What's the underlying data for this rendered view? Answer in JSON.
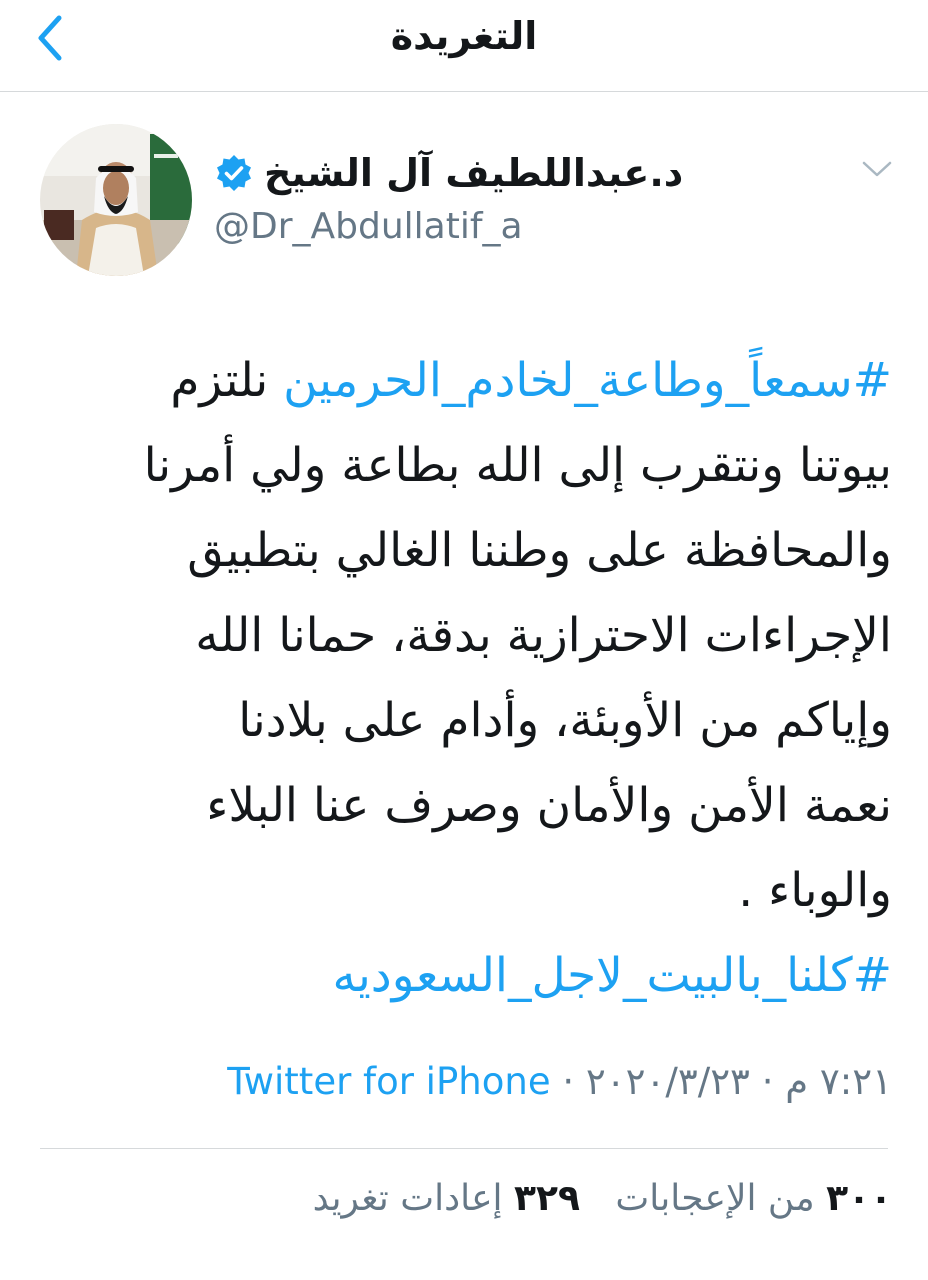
{
  "header": {
    "title": "التغريدة",
    "back_icon": "chevron-left-icon"
  },
  "author": {
    "display_name": "د.عبداللطيف آل الشيخ",
    "handle": "@Dr_Abdullatif_a",
    "verified": true,
    "verified_icon": "verified-badge-icon",
    "more_icon": "chevron-down-icon"
  },
  "tweet": {
    "lines": [
      {
        "hashtag": "#سمعاً_وطاعة_لخادم_الحرمين",
        "text": " نلتزم"
      },
      {
        "hashtag": "",
        "text": "بيوتنا ونتقرب إلى الله بطاعة ولي أمرنا"
      },
      {
        "hashtag": "",
        "text": "والمحافظة على وطننا الغالي بتطبيق"
      },
      {
        "hashtag": "",
        "text": "الإجراءات الاحترازية بدقة، حمانا الله"
      },
      {
        "hashtag": "",
        "text": "وإياكم من الأوبئة، وأدام على بلادنا"
      },
      {
        "hashtag": "",
        "text": "نعمة الأمن والأمان وصرف عنا البلاء"
      },
      {
        "hashtag": "",
        "text": "والوباء ."
      },
      {
        "hashtag": "#كلنا_بالبيت_لاجل_السعوديه",
        "text": ""
      }
    ]
  },
  "meta": {
    "time": "٧:٢١ م",
    "separator": " · ",
    "date": "٢٠٢٠/٣/٢٣",
    "client": "Twitter for iPhone"
  },
  "stats": {
    "retweets_count": "٣٢٩",
    "retweets_label": "إعادات تغريد",
    "likes_count": "٣٠٠",
    "likes_label": "من الإعجابات"
  },
  "colors": {
    "accent": "#1da1f2",
    "text": "#14171a",
    "secondary": "#657786",
    "divider": "#d6d9db"
  }
}
